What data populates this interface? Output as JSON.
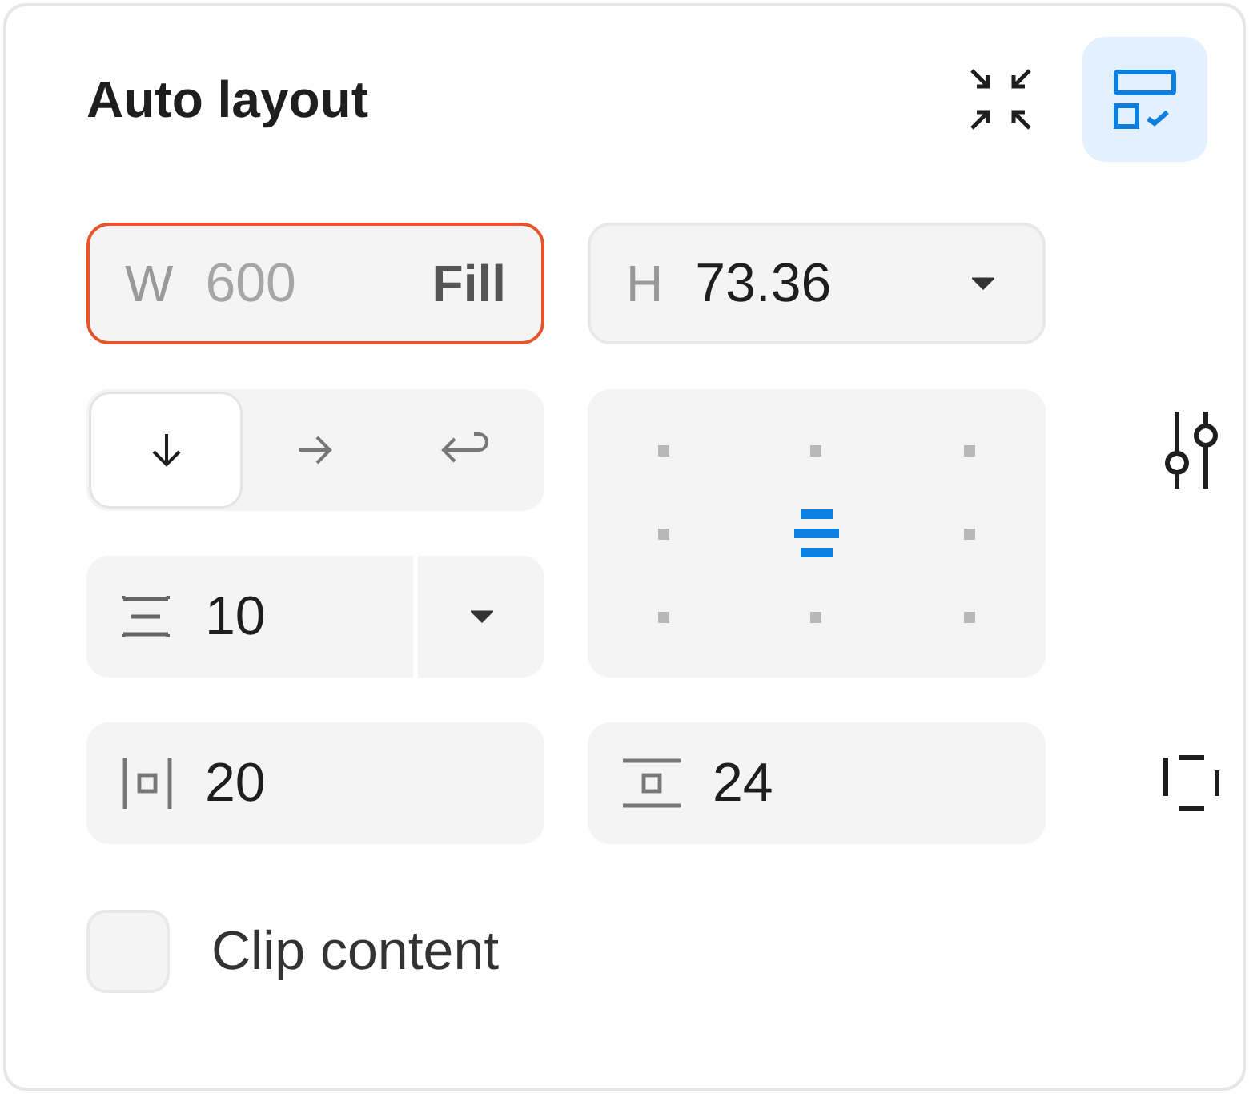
{
  "panel": {
    "title": "Auto layout"
  },
  "layout_toggle": {
    "selected": true
  },
  "width_field": {
    "label": "W",
    "value": "600",
    "mode": "Fill",
    "focused": true
  },
  "height_field": {
    "label": "H",
    "value": "73.36"
  },
  "direction": [
    {
      "kind": "vertical",
      "selected": true
    },
    {
      "kind": "horizontal",
      "selected": false
    },
    {
      "kind": "wrap",
      "selected": false
    }
  ],
  "alignment": [
    {
      "selected": false
    },
    {
      "selected": false
    },
    {
      "selected": false
    },
    {
      "selected": false
    },
    {
      "selected": true
    },
    {
      "selected": false
    },
    {
      "selected": false
    },
    {
      "selected": false
    },
    {
      "selected": false
    }
  ],
  "gap": {
    "value": "10"
  },
  "padding": [
    {
      "kind": "horizontal",
      "value": "20"
    },
    {
      "kind": "vertical",
      "value": "24"
    }
  ],
  "clip_content": {
    "label": "Clip content",
    "checked": false
  }
}
